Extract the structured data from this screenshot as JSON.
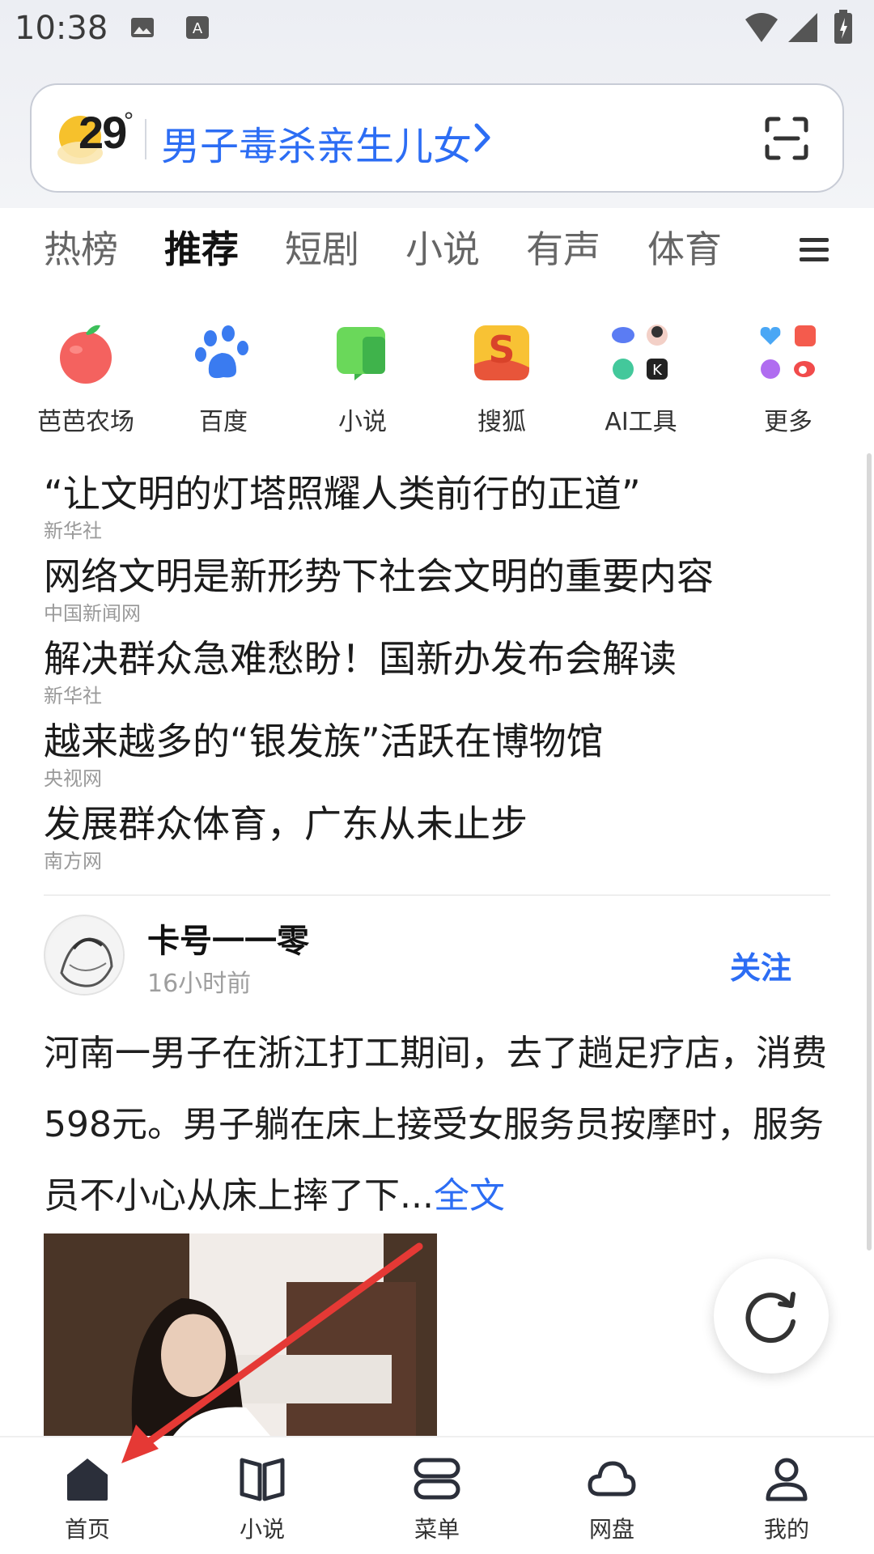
{
  "status_bar": {
    "time": "10:38",
    "icons": [
      "image-icon",
      "text-a-icon",
      "wifi-icon",
      "signal-icon",
      "battery-icon"
    ]
  },
  "search": {
    "temperature": "29",
    "degree": "°",
    "query": "男子毒杀亲生儿女",
    "icons": [
      "weather-sun-icon",
      "chevron-right-icon",
      "scan-icon"
    ]
  },
  "tabs": [
    "热榜",
    "推荐",
    "短剧",
    "小说",
    "有声",
    "体育"
  ],
  "active_tab": "推荐",
  "apps": [
    {
      "label": "芭芭农场",
      "icon": "apple-icon"
    },
    {
      "label": "百度",
      "icon": "paw-icon"
    },
    {
      "label": "小说",
      "icon": "book-green-icon"
    },
    {
      "label": "搜狐",
      "icon": "sohu-icon"
    },
    {
      "label": "AI工具",
      "icon": "ai-tools-grid-icon"
    },
    {
      "label": "更多",
      "icon": "more-grid-icon"
    }
  ],
  "hot_list": [
    {
      "title": "“让文明的灯塔照耀人类前行的正道”",
      "source": "新华社"
    },
    {
      "title": "网络文明是新形势下社会文明的重要内容",
      "source": "中国新闻网"
    },
    {
      "title": "解决群众急难愁盼！国新办发布会解读",
      "source": "新华社"
    },
    {
      "title": "越来越多的“银发族”活跃在博物馆",
      "source": "央视网"
    },
    {
      "title": "发展群众体育，广东从未止步",
      "source": "南方网"
    }
  ],
  "post": {
    "author": "卡号一一零",
    "time": "16小时前",
    "follow": "关注",
    "body": "河南一男子在浙江打工期间，去了趟足疗店，消费598元。男子躺在床上接受女服务员按摩时，服务员不小心从床上摔了下...",
    "more": "全文"
  },
  "bottom_nav": [
    {
      "label": "首页",
      "icon": "home-icon"
    },
    {
      "label": "小说",
      "icon": "open-book-icon"
    },
    {
      "label": "菜单",
      "icon": "menu-stack-icon"
    },
    {
      "label": "网盘",
      "icon": "cloud-icon"
    },
    {
      "label": "我的",
      "icon": "user-icon"
    }
  ],
  "colors": {
    "accent": "#2c6df4",
    "annotation_arrow": "#e53935"
  }
}
